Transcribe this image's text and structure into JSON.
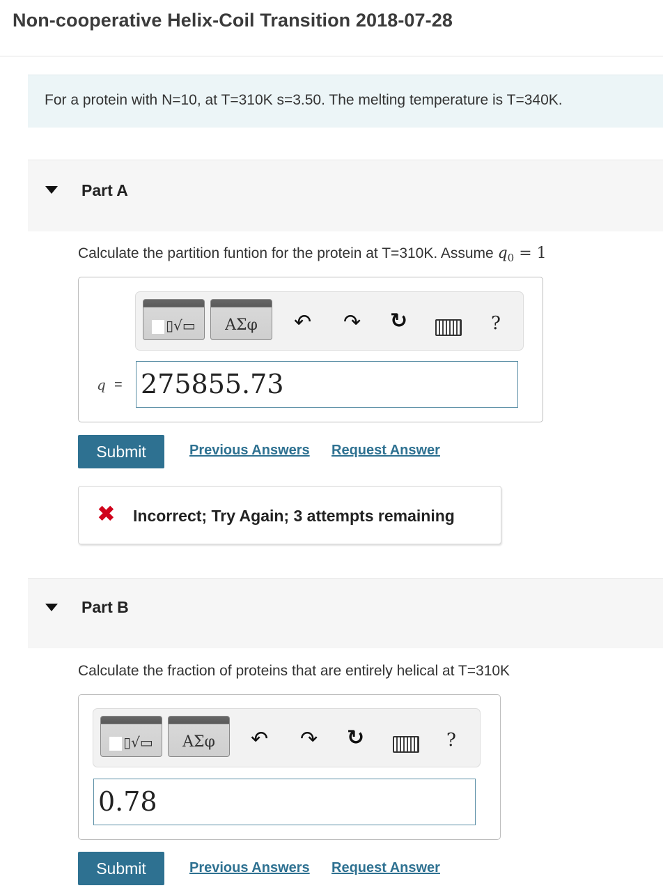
{
  "title": "Non-cooperative Helix-Coil Transition 2018-07-28",
  "intro": "For a protein with N=10, at T=310K s=3.50. The melting temperature is T=340K.",
  "parts": [
    {
      "label": "Part A",
      "question": "Calculate the partition funtion for the protein at T=310K. Assume ",
      "question_math_var": "q",
      "question_math_sub": "0",
      "question_math_rest": " = 1",
      "toolbar": {
        "templates_icon": "radical-template-icon",
        "greek_label": "ΑΣφ",
        "undo_icon": "undo-icon",
        "redo_icon": "redo-icon",
        "reset_icon": "reset-icon",
        "keyboard_icon": "keyboard-icon",
        "help_label": "?"
      },
      "var_label": "q",
      "eq_sign": "=",
      "answer_value": "275855.73",
      "submit_label": "Submit",
      "prev_answers_label": "Previous Answers",
      "request_answer_label": "Request Answer",
      "feedback": {
        "icon": "x-icon",
        "icon_glyph": "✖",
        "text": "Incorrect; Try Again; 3 attempts remaining"
      }
    },
    {
      "label": "Part B",
      "question": "Calculate the fraction of  proteins  that are entirely  helical at T=310K",
      "toolbar": {
        "templates_icon": "radical-template-icon",
        "greek_label": "ΑΣφ",
        "undo_icon": "undo-icon",
        "redo_icon": "redo-icon",
        "reset_icon": "reset-icon",
        "keyboard_icon": "keyboard-icon",
        "help_label": "?"
      },
      "answer_value": "0.78",
      "submit_label": "Submit",
      "prev_answers_label": "Previous Answers",
      "request_answer_label": "Request Answer"
    }
  ],
  "colors": {
    "accent": "#2e7191",
    "error": "#d0021b",
    "intro_bg": "#ecf5f7",
    "part_bg": "#f6f6f6"
  }
}
